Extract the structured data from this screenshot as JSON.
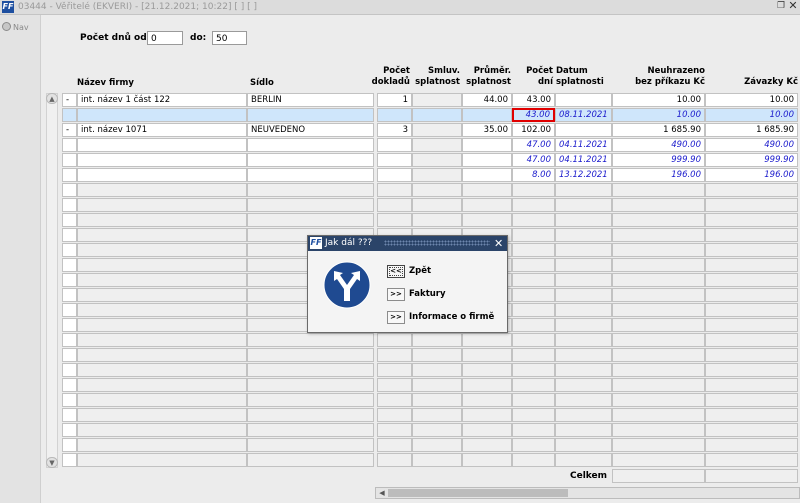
{
  "window": {
    "title": "03444 - Věřitelé (EKVERI) - [21.12.2021; 10:22]  [ ]  [ ]",
    "app_icon": "FF",
    "restore_icon": "restore-icon",
    "close_icon": "close-icon"
  },
  "nav": {
    "label": "Nav"
  },
  "filter": {
    "from_label": "Počet dnů od:",
    "from_value": "0",
    "to_label": "do:",
    "to_value": "50"
  },
  "columns": {
    "firm": "Název firmy",
    "seat": "Sídlo",
    "doc_count_1": "Počet",
    "doc_count_2": "dokladů",
    "contract_1": "Smluv.",
    "contract_2": "splatnost",
    "avg_1": "Průměr.",
    "avg_2": "splatnost",
    "days_1": "Počet",
    "days_2": "dní",
    "due_1": "Datum",
    "due_2": "splatnosti",
    "unpaid_1": "Neuhrazeno",
    "unpaid_2": "bez příkazu Kč",
    "liab_1": "Závazky Kč"
  },
  "rows": [
    {
      "marker": "-",
      "firm": "int. název 1 část 122",
      "seat": "BERLIN",
      "docs": "1",
      "contract": "",
      "avg": "44.00",
      "days": "43.00",
      "due": "",
      "unpaid": "10.00",
      "liab": "10.00"
    },
    {
      "marker": "",
      "firm": "",
      "seat": "",
      "docs": "",
      "contract": "",
      "avg": "",
      "days": "43.00",
      "due": "08.11.2021",
      "unpaid": "10.00",
      "liab": "10.00"
    },
    {
      "marker": "-",
      "firm": "int. název 1071",
      "seat": "NEUVEDENO",
      "docs": "3",
      "contract": "",
      "avg": "35.00",
      "days": "102.00",
      "due": "",
      "unpaid": "1 685.90",
      "liab": "1 685.90"
    },
    {
      "marker": "",
      "firm": "",
      "seat": "",
      "docs": "",
      "contract": "",
      "avg": "",
      "days": "47.00",
      "due": "04.11.2021",
      "unpaid": "490.00",
      "liab": "490.00"
    },
    {
      "marker": "",
      "firm": "",
      "seat": "",
      "docs": "",
      "contract": "",
      "avg": "",
      "days": "47.00",
      "due": "04.11.2021",
      "unpaid": "999.90",
      "liab": "999.90"
    },
    {
      "marker": "",
      "firm": "",
      "seat": "",
      "docs": "",
      "contract": "",
      "avg": "",
      "days": "8.00",
      "due": "13.12.2021",
      "unpaid": "196.00",
      "liab": "196.00"
    }
  ],
  "total": {
    "label": "Celkem"
  },
  "dialog": {
    "title": "Jak dál ???",
    "options": [
      {
        "button": "<<",
        "label": "Zpět"
      },
      {
        "button": ">>",
        "label": "Faktury"
      },
      {
        "button": ">>",
        "label": "Informace o firmě"
      }
    ]
  },
  "colors": {
    "header_bar": "#2b4469",
    "detail_text": "#1a1acc",
    "selected_row": "#cfe6fb",
    "focus_box": "#e00000"
  }
}
